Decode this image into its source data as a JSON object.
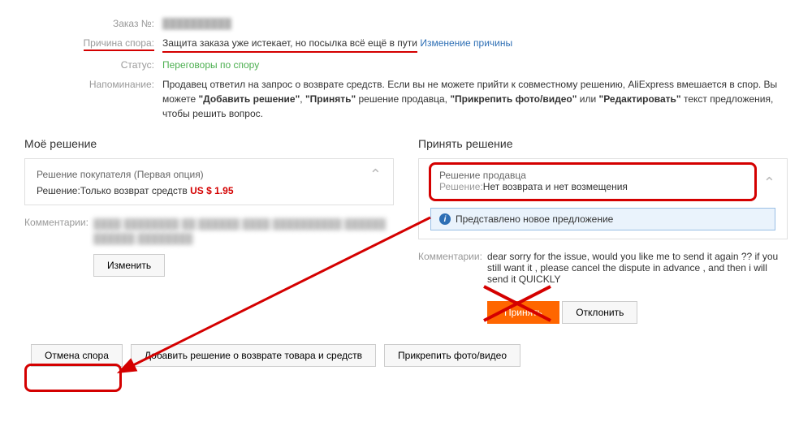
{
  "info": {
    "order_label": "Заказ №:",
    "order_value": "██████████",
    "reason_label": "Причина спора:",
    "reason_text": "Защита заказа уже истекает, но посылка всё ещё в пути",
    "reason_link": "Изменение причины",
    "status_label": "Статус:",
    "status_value": "Переговоры по спору",
    "reminder_label": "Напоминание:",
    "reminder_html": "Продавец ответил на запрос о возврате средств. Если вы не можете прийти к совместному решению, AliExpress вмешается в спор. Вы можете \"Добавить решение\", \"Принять\" решение продавца, \"Прикрепить фото/видео\" или \"Редактировать\" текст предложения, чтобы решить вопрос."
  },
  "buyer": {
    "title": "Моё решение",
    "panel_title": "Решение покупателя (Первая опция)",
    "decision_label": "Решение:",
    "decision_value": "Только возврат средств",
    "price": "US $ 1.95",
    "comments_label": "Комментарии:",
    "comments_blur": "████ ████████ ██ ██████ ████ ██████████ ██████ ██████ ████████",
    "edit_btn": "Изменить"
  },
  "seller": {
    "title": "Принять решение",
    "panel_title": "Решение продавца",
    "decision_label": "Решение:",
    "decision_value": "Нет возврата и нет возмещения",
    "notice": "Представлено новое предложение",
    "comments_label": "Комментарии:",
    "comments_text": "dear sorry for the issue, would you like me to send it again ?? if you still want it , please cancel the dispute in advance , and then i will send it QUICKLY",
    "accept_btn": "Принять",
    "reject_btn": "Отклонить"
  },
  "footer": {
    "cancel": "Отмена спора",
    "add": "Добавить решение о возврате товара и средств",
    "attach": "Прикрепить фото/видео"
  }
}
